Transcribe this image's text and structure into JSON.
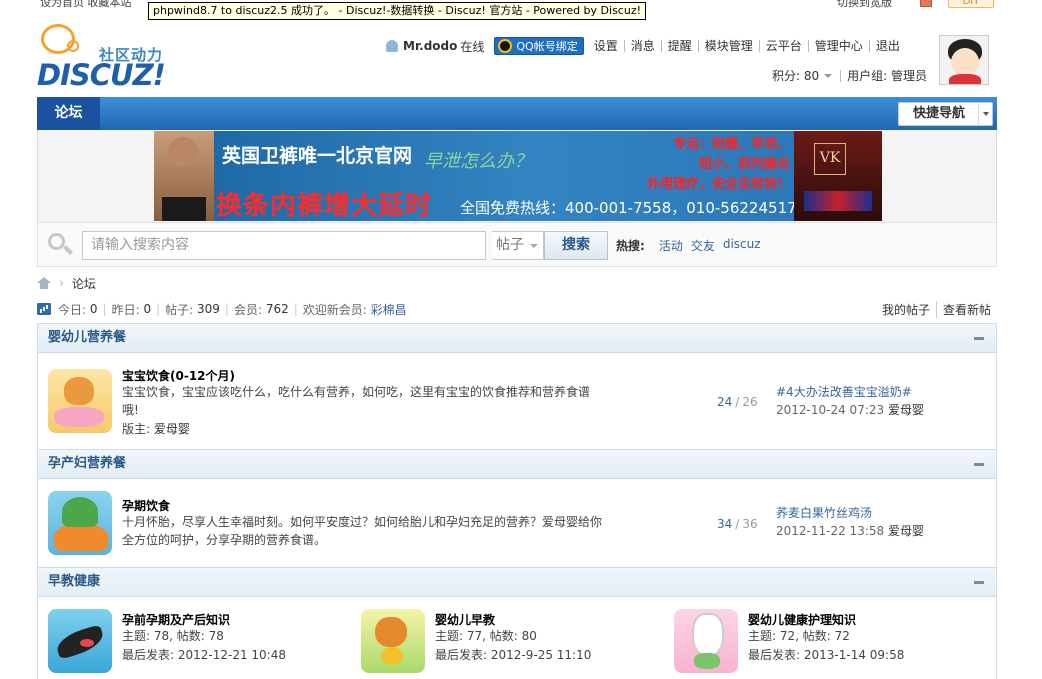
{
  "topbar": {
    "left": "设为首页  收藏本站",
    "right": "切换到宽版",
    "diy": "DIY"
  },
  "tooltip": "phpwind8.7 to discuz2.5 成功了。 - Discuz!-数据转换 - Discuz! 官方站 - Powered by Discuz!",
  "logo": {
    "tagline": "社区动力",
    "word": "DISCUZ!"
  },
  "user": {
    "name": "Mr.dodo",
    "status": "在线",
    "qq_bind": "QQ帐号绑定",
    "links": [
      "设置",
      "消息",
      "提醒",
      "模块管理",
      "云平台",
      "管理中心",
      "退出"
    ],
    "points_label": "积分: 80",
    "group_label": "用户组: 管理员"
  },
  "nav": {
    "tab": "论坛",
    "quick": "快捷导航"
  },
  "banner": {
    "t1": "英国卫裤唯一北京官网",
    "t2": "早泄怎么办？",
    "t3": "换条内裤增大延时",
    "t4": "全国免费热线：400-001-7558，010-56224517",
    "red1": "专治：阳痿、早泄、",
    "red2": "短小、前列腺炎",
    "red3": "外用理疗，安全见效快！"
  },
  "search": {
    "placeholder": "请输入搜索内容",
    "type": "帖子",
    "button": "搜索",
    "hot_label": "热搜:",
    "keywords": [
      "活动",
      "交友",
      "discuz"
    ]
  },
  "breadcrumb": {
    "current": "论坛"
  },
  "stats": {
    "today_label": "今日:",
    "today": "0",
    "yesterday_label": "昨日:",
    "yesterday": "0",
    "posts_label": "帖子:",
    "posts": "309",
    "members_label": "会员:",
    "members": "762",
    "welcome_label": "欢迎新会员:",
    "newest": "彩棉昌",
    "my_posts": "我的帖子",
    "new_posts": "查看新帖"
  },
  "groups": [
    {
      "title": "婴幼儿营养餐",
      "forums": [
        {
          "name": "宝宝饮食(0-12个月)",
          "desc1": "宝宝饮食，宝宝应该吃什么，吃什么有营养，如何吃，这里有宝宝的饮食推荐和营养食谱",
          "desc2": "哦!",
          "mod_label": "版主:",
          "mod": "爱母婴",
          "threads": "24",
          "posts": "26",
          "last_title": "#4大办法改善宝宝溢奶#",
          "last_time": "2012-10-24 07:23",
          "last_user": "爱母婴"
        }
      ]
    },
    {
      "title": "孕产妇营养餐",
      "forums": [
        {
          "name": "孕期饮食",
          "desc1": "十月怀胎，尽享人生幸福时刻。如何平安度过？如何给胎儿和孕妇充足的营养？爱母婴给你",
          "desc2": "全方位的呵护，分享孕期的营养食谱。",
          "threads": "34",
          "posts": "36",
          "last_title": "荞麦白果竹丝鸡汤",
          "last_time": "2012-11-22 13:58",
          "last_user": "爱母婴"
        }
      ]
    },
    {
      "title": "早教健康",
      "cells": [
        {
          "name": "孕前孕期及产后知识",
          "stat": "主题: 78, 帖数: 78",
          "last": "最后发表: 2012-12-21 10:48"
        },
        {
          "name": "婴幼儿早教",
          "stat": "主题: 77, 帖数: 80",
          "last": "最后发表: 2012-9-25 11:10"
        },
        {
          "name": "婴幼儿健康护理知识",
          "stat": "主题: 72, 帖数: 72",
          "last": "最后发表: 2013-1-14 09:58"
        }
      ]
    }
  ]
}
